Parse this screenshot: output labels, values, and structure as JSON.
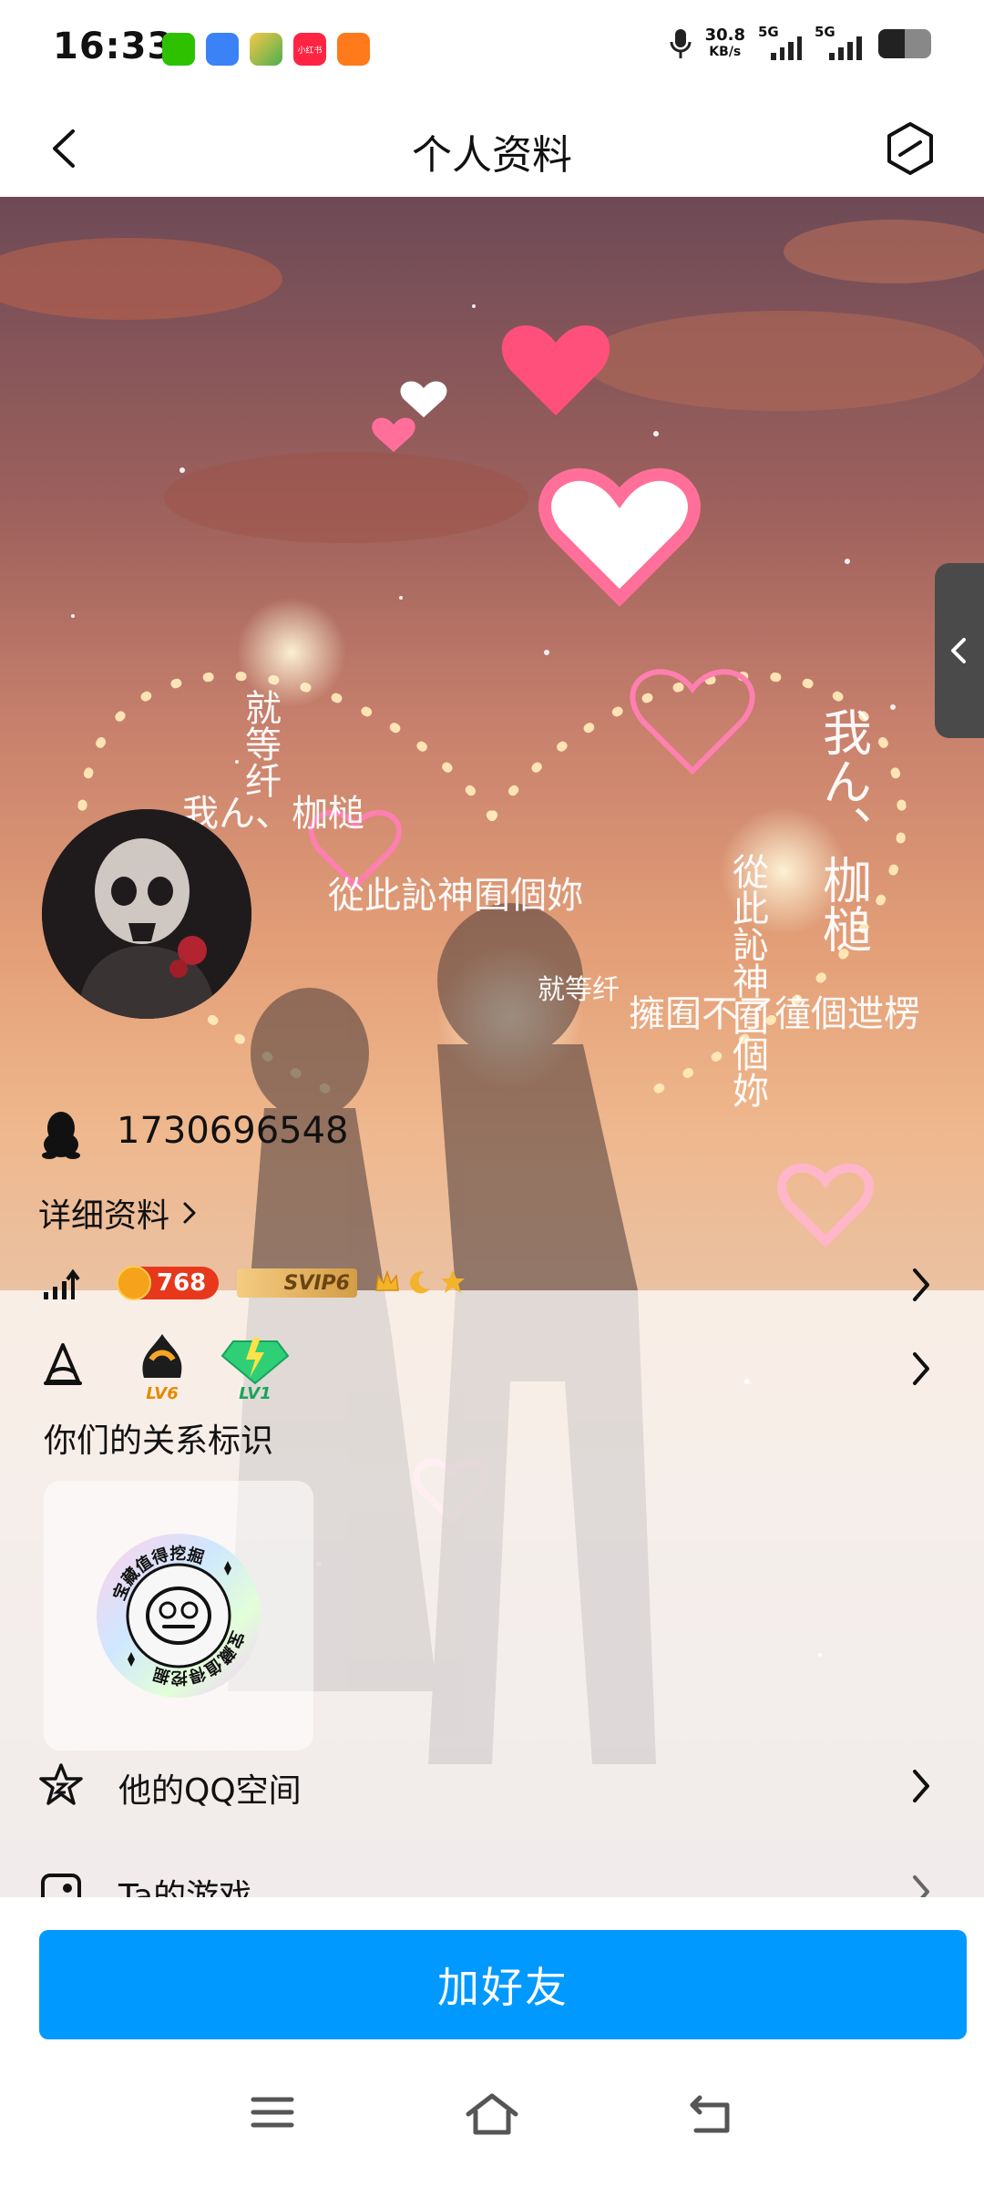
{
  "status_bar": {
    "time": "16:33",
    "net_speed_value": "30.8",
    "net_speed_unit": "KB/s",
    "signal1_label": "5G",
    "signal2_label": "5G",
    "notification_icons": [
      "wechat-icon",
      "browser-icon",
      "video-app-icon",
      "xiaohongshu-icon",
      "game-app-icon"
    ],
    "notification_badge_text": "小红书"
  },
  "header": {
    "title": "个人资料"
  },
  "cover": {
    "text_lines": [
      "就等纤",
      "我ん、枷槌",
      "從此訫神囿個妳",
      "就等纤",
      "擁囿不了徸個迣楞",
      "我ん、枷槌",
      "從此訫神囿個妳"
    ]
  },
  "profile": {
    "qq_number": "1730696548",
    "detail_link": "详细资料",
    "coin_value": "768",
    "svip_label": "SVIP6",
    "lv6_label": "LV6",
    "lv1_label": "LV1",
    "relation_title": "你们的关系标识",
    "relation_badge_text": "宝藏值得挖掘"
  },
  "menu": {
    "qzone_label": "他的QQ空间",
    "games_label": "Ta的游戏"
  },
  "actions": {
    "add_friend_label": "加好友"
  },
  "colors": {
    "primary_button": "#0099ff",
    "coin_red": "#e8381c",
    "svip_gold": "#d49d45"
  }
}
